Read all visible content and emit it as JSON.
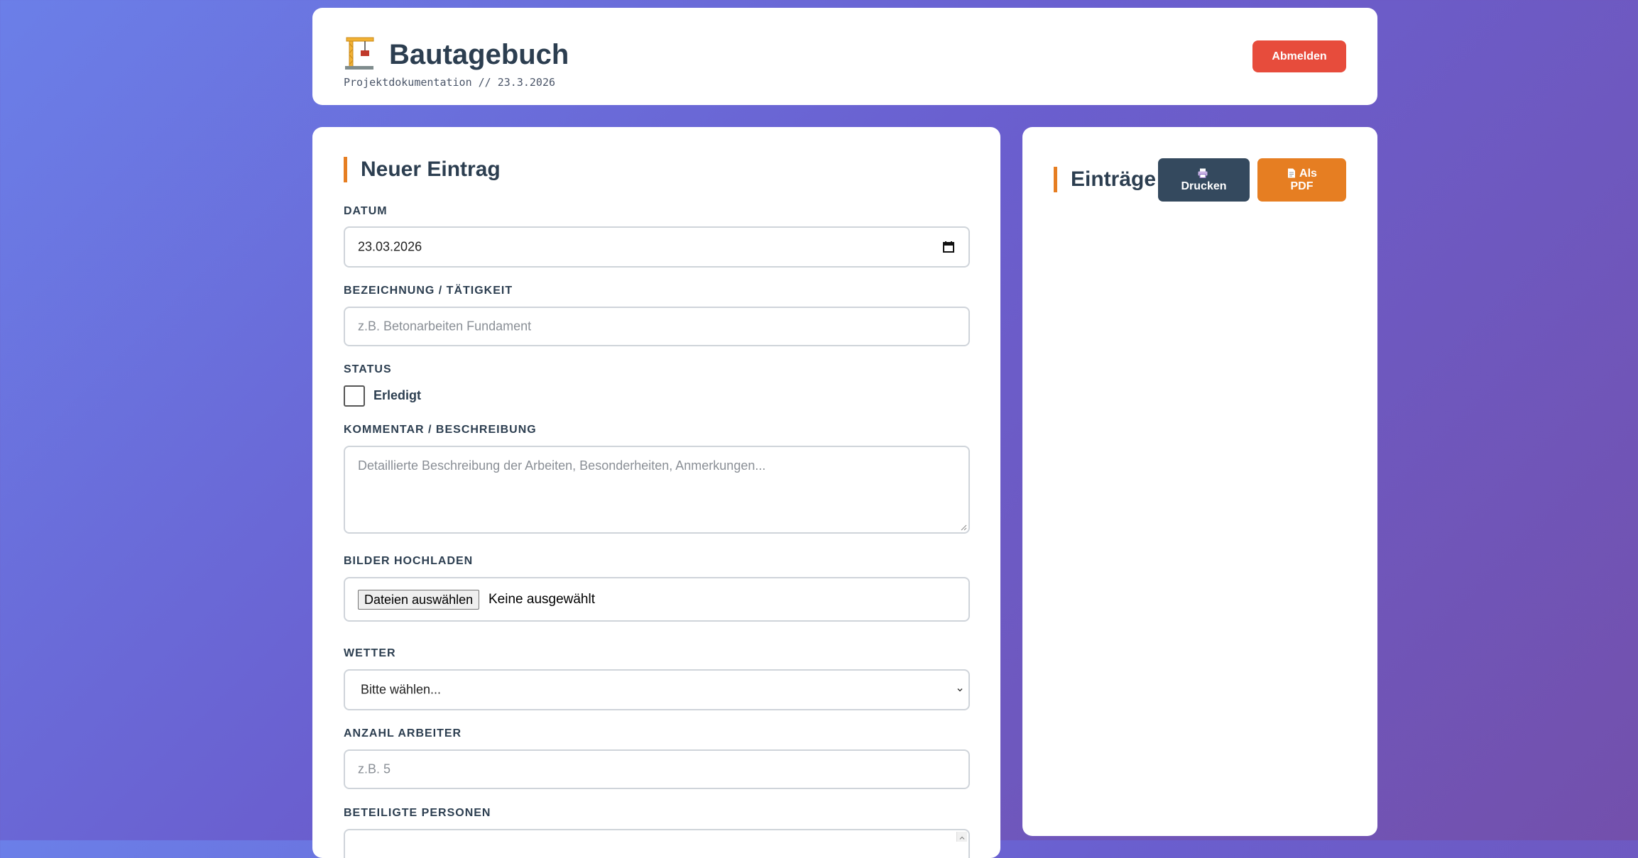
{
  "header": {
    "title": "Bautagebuch",
    "subtitle": "Projektdokumentation // 23.3.2026",
    "logout_label": "Abmelden",
    "icon": "construction-crane-icon"
  },
  "form": {
    "title": "Neuer Eintrag",
    "date": {
      "label": "DATUM",
      "value": "23.03.2026",
      "icon": "calendar-icon"
    },
    "activity": {
      "label": "BEZEICHNUNG / TÄTIGKEIT",
      "placeholder": "z.B. Betonarbeiten Fundament",
      "value": ""
    },
    "status": {
      "label": "STATUS",
      "checkbox_label": "Erledigt",
      "checked": false
    },
    "comment": {
      "label": "KOMMENTAR / BESCHREIBUNG",
      "placeholder": "Detaillierte Beschreibung der Arbeiten, Besonderheiten, Anmerkungen...",
      "value": ""
    },
    "images": {
      "label": "BILDER HOCHLADEN",
      "button_label": "Dateien auswählen",
      "status": "Keine ausgewählt"
    },
    "weather": {
      "label": "WETTER",
      "selected": "Bitte wählen..."
    },
    "workers": {
      "label": "ANZAHL ARBEITER",
      "placeholder": "z.B. 5",
      "value": ""
    },
    "persons": {
      "label": "BETEILIGTE PERSONEN"
    }
  },
  "entries": {
    "title": "Einträge",
    "print_label": "Drucken",
    "print_icon": "printer-icon",
    "pdf_label_line1": "Als",
    "pdf_label_line2": "PDF",
    "pdf_icon": "document-icon"
  },
  "colors": {
    "accent": "#e67e22",
    "danger": "#e74c3c",
    "dark": "#34495e",
    "text": "#2c3e50",
    "bg_start": "#6b7fe8",
    "bg_end": "#7350ac"
  }
}
